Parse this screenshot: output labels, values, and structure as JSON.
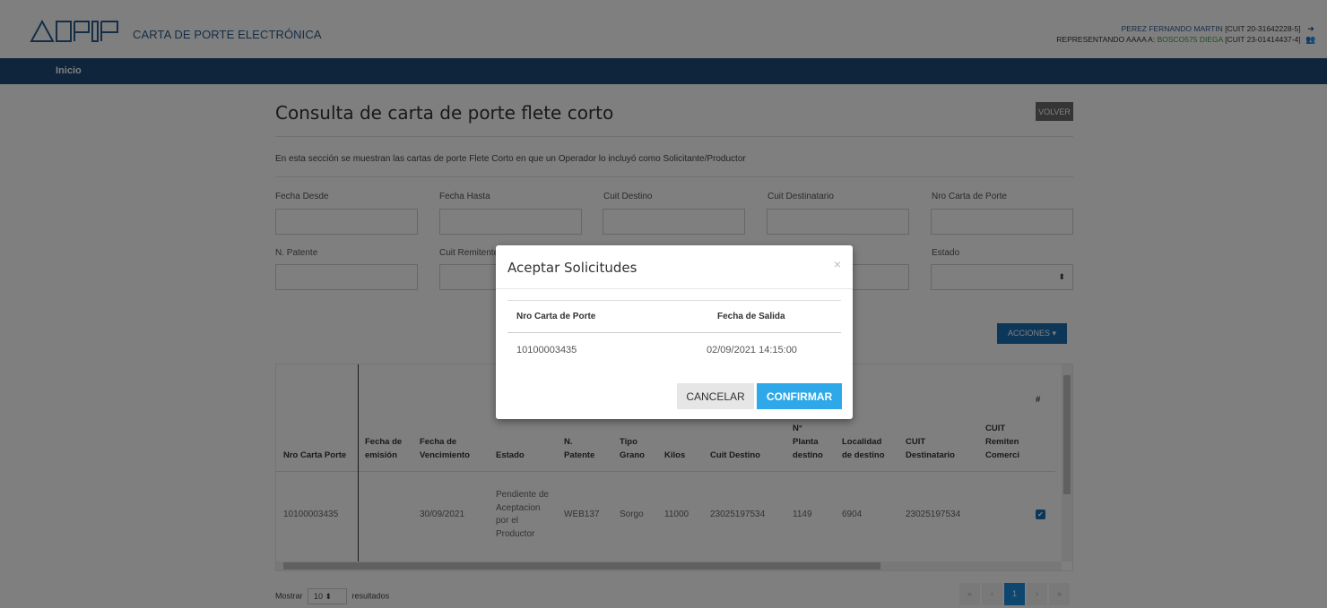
{
  "header": {
    "brand": "CARTA DE PORTE ELECTRÓNICA",
    "user_name": "PEREZ FERNANDO MARTIN",
    "user_cuit": "[CUIT 20-31642228-5]",
    "rep_prefix": "REPRESENTANDO AAAA A:",
    "rep_name": "BOSCO575 DIEGA",
    "rep_cuit": "[CUIT 23-01414437-4]"
  },
  "nav": {
    "inicio": "Inicio"
  },
  "page": {
    "title": "Consulta de carta de porte flete corto",
    "volver": "VOLVER",
    "description": "En esta sección se muestran las cartas de porte Flete Corto en que un Operador lo incluyó como Solicitante/Productor",
    "acciones": "ACCIONES ▾"
  },
  "filters": {
    "fecha_desde": "Fecha Desde",
    "fecha_hasta": "Fecha Hasta",
    "cuit_destino": "Cuit Destino",
    "cuit_destinatario": "Cuit Destinatario",
    "nro_carta": "Nro Carta de Porte",
    "patente": "N. Patente",
    "cuit_remitente": "Cuit Remitente",
    "estado": "Estado",
    "select_caret": "⬍"
  },
  "table": {
    "headers": [
      "Nro Carta Porte",
      "Fecha de emisión",
      "Fecha de Vencimiento",
      "Estado",
      "N. Patente",
      "Tipo Grano",
      "Kilos",
      "Cuit Destino",
      "N° Planta destino",
      "Localidad de destino",
      "CUIT Destinatario",
      "CUIT Remiten Comerci",
      "#"
    ],
    "rows": [
      [
        "10100003435",
        "",
        "30/09/2021",
        "Pendiente de Aceptacion por el Productor",
        "WEB137",
        "Sorgo",
        "11000",
        "23025197534",
        "1149",
        "6904",
        "23025197534",
        "",
        "✔"
      ]
    ]
  },
  "footer": {
    "mostrar": "Mostrar",
    "page_size": "10 ⬍",
    "resultados": "resultados",
    "pager": [
      "«",
      "‹",
      "1",
      "›",
      "»"
    ]
  },
  "modal": {
    "title": "Aceptar Solicitudes",
    "close": "×",
    "col1": "Nro Carta de Porte",
    "col2": "Fecha de Salida",
    "nro": "10100003435",
    "fecha": "02/09/2021 14:15:00",
    "cancel": "CANCELAR",
    "confirm": "CONFIRMAR"
  }
}
